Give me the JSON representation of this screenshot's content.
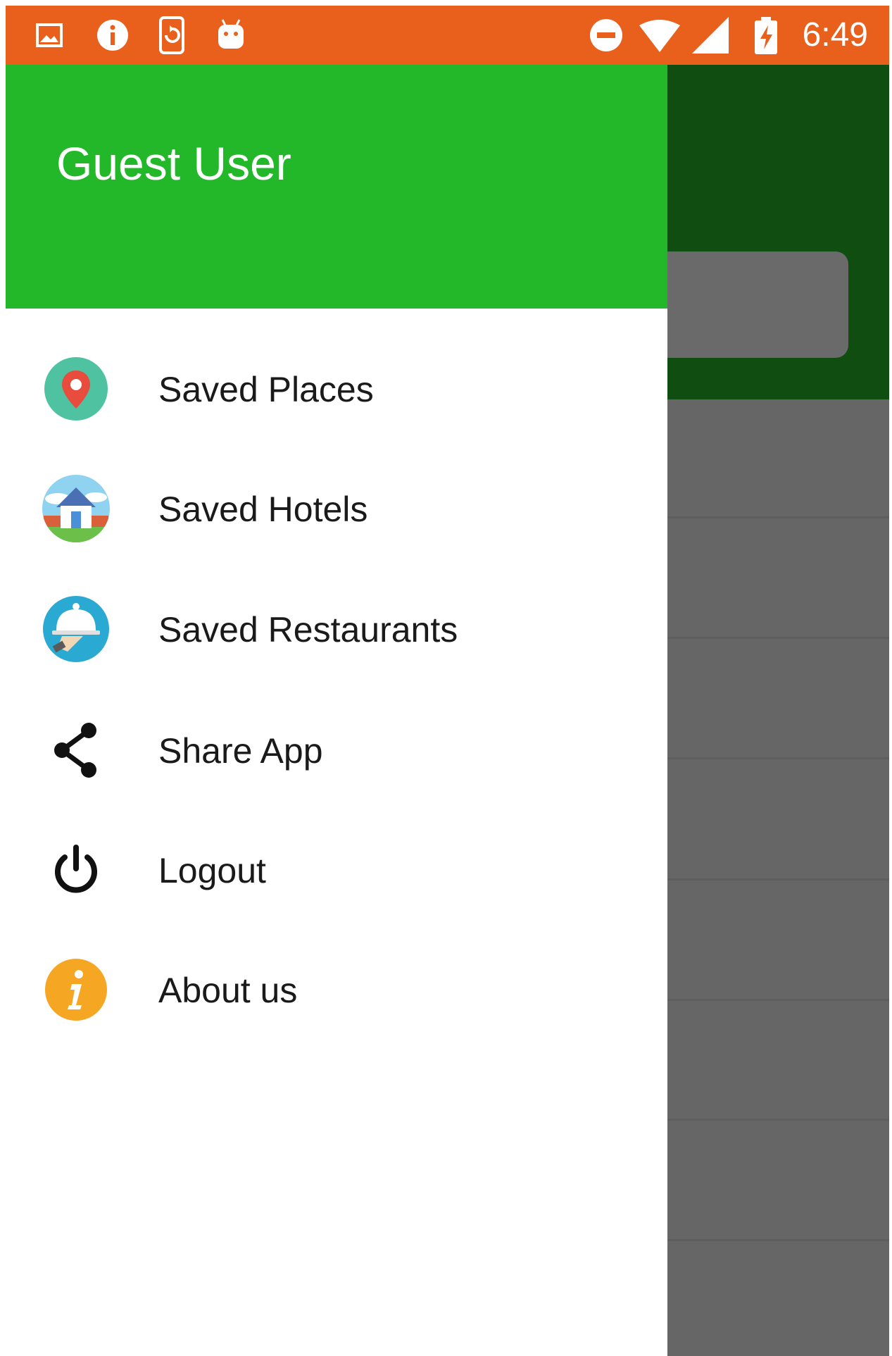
{
  "status_bar": {
    "time": "6:49",
    "left_icons": [
      "gallery-icon",
      "info-icon",
      "screen-rotation-icon",
      "android-icon"
    ],
    "right_icons": [
      "do-not-disturb-icon",
      "wifi-icon",
      "cell-signal-icon",
      "battery-charging-icon"
    ]
  },
  "drawer": {
    "header": {
      "user_name": "Guest User"
    },
    "items": [
      {
        "label": "Saved Places",
        "icon": "location-pin-icon"
      },
      {
        "label": "Saved Hotels",
        "icon": "house-icon"
      },
      {
        "label": "Saved Restaurants",
        "icon": "restaurant-cloche-icon"
      },
      {
        "label": "Share App",
        "icon": "share-icon"
      },
      {
        "label": "Logout",
        "icon": "power-icon"
      },
      {
        "label": "About us",
        "icon": "info-icon"
      }
    ]
  },
  "colors": {
    "status_bar": "#e8601c",
    "drawer_header": "#23b82a",
    "background_toolbar": "#0f4d10",
    "scrim": "#666666"
  }
}
